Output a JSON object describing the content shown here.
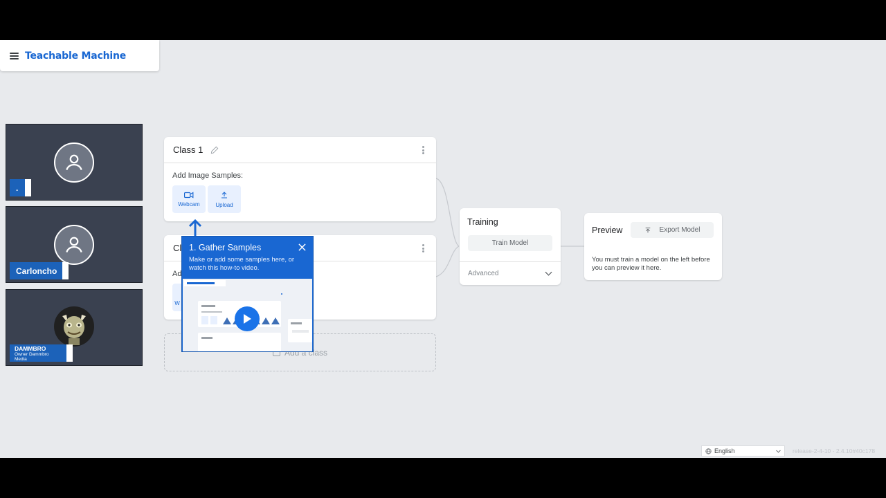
{
  "header": {
    "title": "Teachable Machine"
  },
  "participants": [
    {
      "name": ".",
      "subtitle": ""
    },
    {
      "name": "Carloncho",
      "subtitle": ""
    },
    {
      "name": "DAMMBRO",
      "subtitle": "Owner Dammbro Media"
    }
  ],
  "classes": [
    {
      "title": "Class 1",
      "samples_label": "Add Image Samples:",
      "webcam_label": "Webcam",
      "upload_label": "Upload"
    },
    {
      "title": "Cl",
      "samples_label": "Ad",
      "webcam_label": "W"
    }
  ],
  "add_class_label": "Add a class",
  "tutorial": {
    "title": "1. Gather Samples",
    "text": "Make or add some samples here, or watch this how-to video."
  },
  "training": {
    "title": "Training",
    "train_button": "Train Model",
    "advanced_label": "Advanced"
  },
  "preview": {
    "title": "Preview",
    "export_button": "Export Model",
    "note": "You must train a model on the left before you can preview it here."
  },
  "footer": {
    "language": "English",
    "release": "release-2-4-10 - 2.4.10#40c178"
  },
  "colors": {
    "accent": "#1967d2",
    "tile_bg": "#3a4150",
    "nameplate": "#1c62b9"
  }
}
